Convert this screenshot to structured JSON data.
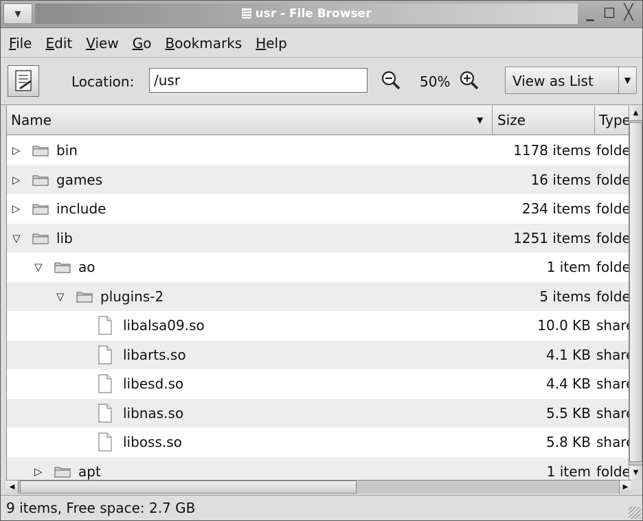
{
  "window": {
    "title": "usr - File Browser",
    "menu_glyph": "▼",
    "minimize_glyph": "_",
    "maximize_glyph": "☐",
    "close_glyph": "╳"
  },
  "menubar": {
    "items": [
      {
        "accel": "F",
        "rest": "ile"
      },
      {
        "accel": "E",
        "rest": "dit"
      },
      {
        "accel": "V",
        "rest": "iew"
      },
      {
        "accel": "G",
        "rest": "o"
      },
      {
        "accel": "B",
        "rest": "ookmarks"
      },
      {
        "accel": "H",
        "rest": "elp"
      }
    ]
  },
  "toolbar": {
    "location_label": "Location:",
    "location_value": "/usr",
    "zoom_level": "50%",
    "view_as_label": "View as List",
    "view_as_arrow": "▼",
    "note_icon": "notepad-icon",
    "zoom_out_icon": "zoom-out-icon",
    "zoom_in_icon": "zoom-in-icon"
  },
  "columns": {
    "name": "Name",
    "name_sort_glyph": "▼",
    "size": "Size",
    "type": "Type"
  },
  "rows": [
    {
      "name": "bin",
      "kind": "folder",
      "depth": 0,
      "expander": "closed",
      "size": "1178 items",
      "type": "folder"
    },
    {
      "name": "games",
      "kind": "folder",
      "depth": 0,
      "expander": "closed",
      "size": "16 items",
      "type": "folder"
    },
    {
      "name": "include",
      "kind": "folder",
      "depth": 0,
      "expander": "closed",
      "size": "234 items",
      "type": "folder"
    },
    {
      "name": "lib",
      "kind": "folder",
      "depth": 0,
      "expander": "open",
      "size": "1251 items",
      "type": "folder"
    },
    {
      "name": "ao",
      "kind": "folder",
      "depth": 1,
      "expander": "open",
      "size": "1 item",
      "type": "folder"
    },
    {
      "name": "plugins-2",
      "kind": "folder",
      "depth": 2,
      "expander": "open",
      "size": "5 items",
      "type": "folder"
    },
    {
      "name": "libalsa09.so",
      "kind": "file",
      "depth": 3,
      "expander": "none",
      "size": "10.0 KB",
      "type": "shared library"
    },
    {
      "name": "libarts.so",
      "kind": "file",
      "depth": 3,
      "expander": "none",
      "size": "4.1 KB",
      "type": "shared library"
    },
    {
      "name": "libesd.so",
      "kind": "file",
      "depth": 3,
      "expander": "none",
      "size": "4.4 KB",
      "type": "shared library"
    },
    {
      "name": "libnas.so",
      "kind": "file",
      "depth": 3,
      "expander": "none",
      "size": "5.5 KB",
      "type": "shared library"
    },
    {
      "name": "liboss.so",
      "kind": "file",
      "depth": 3,
      "expander": "none",
      "size": "5.8 KB",
      "type": "shared library"
    },
    {
      "name": "apt",
      "kind": "folder",
      "depth": 1,
      "expander": "closed",
      "size": "1 item",
      "type": "folder"
    }
  ],
  "statusbar": {
    "text": "9 items, Free space: 2.7 GB"
  },
  "scroll": {
    "up_glyph": "▲",
    "down_glyph": "▼",
    "left_glyph": "◀",
    "right_glyph": "▶"
  },
  "colors": {
    "row_alt": "#ededed",
    "title_bar": "#a6a6a6"
  }
}
